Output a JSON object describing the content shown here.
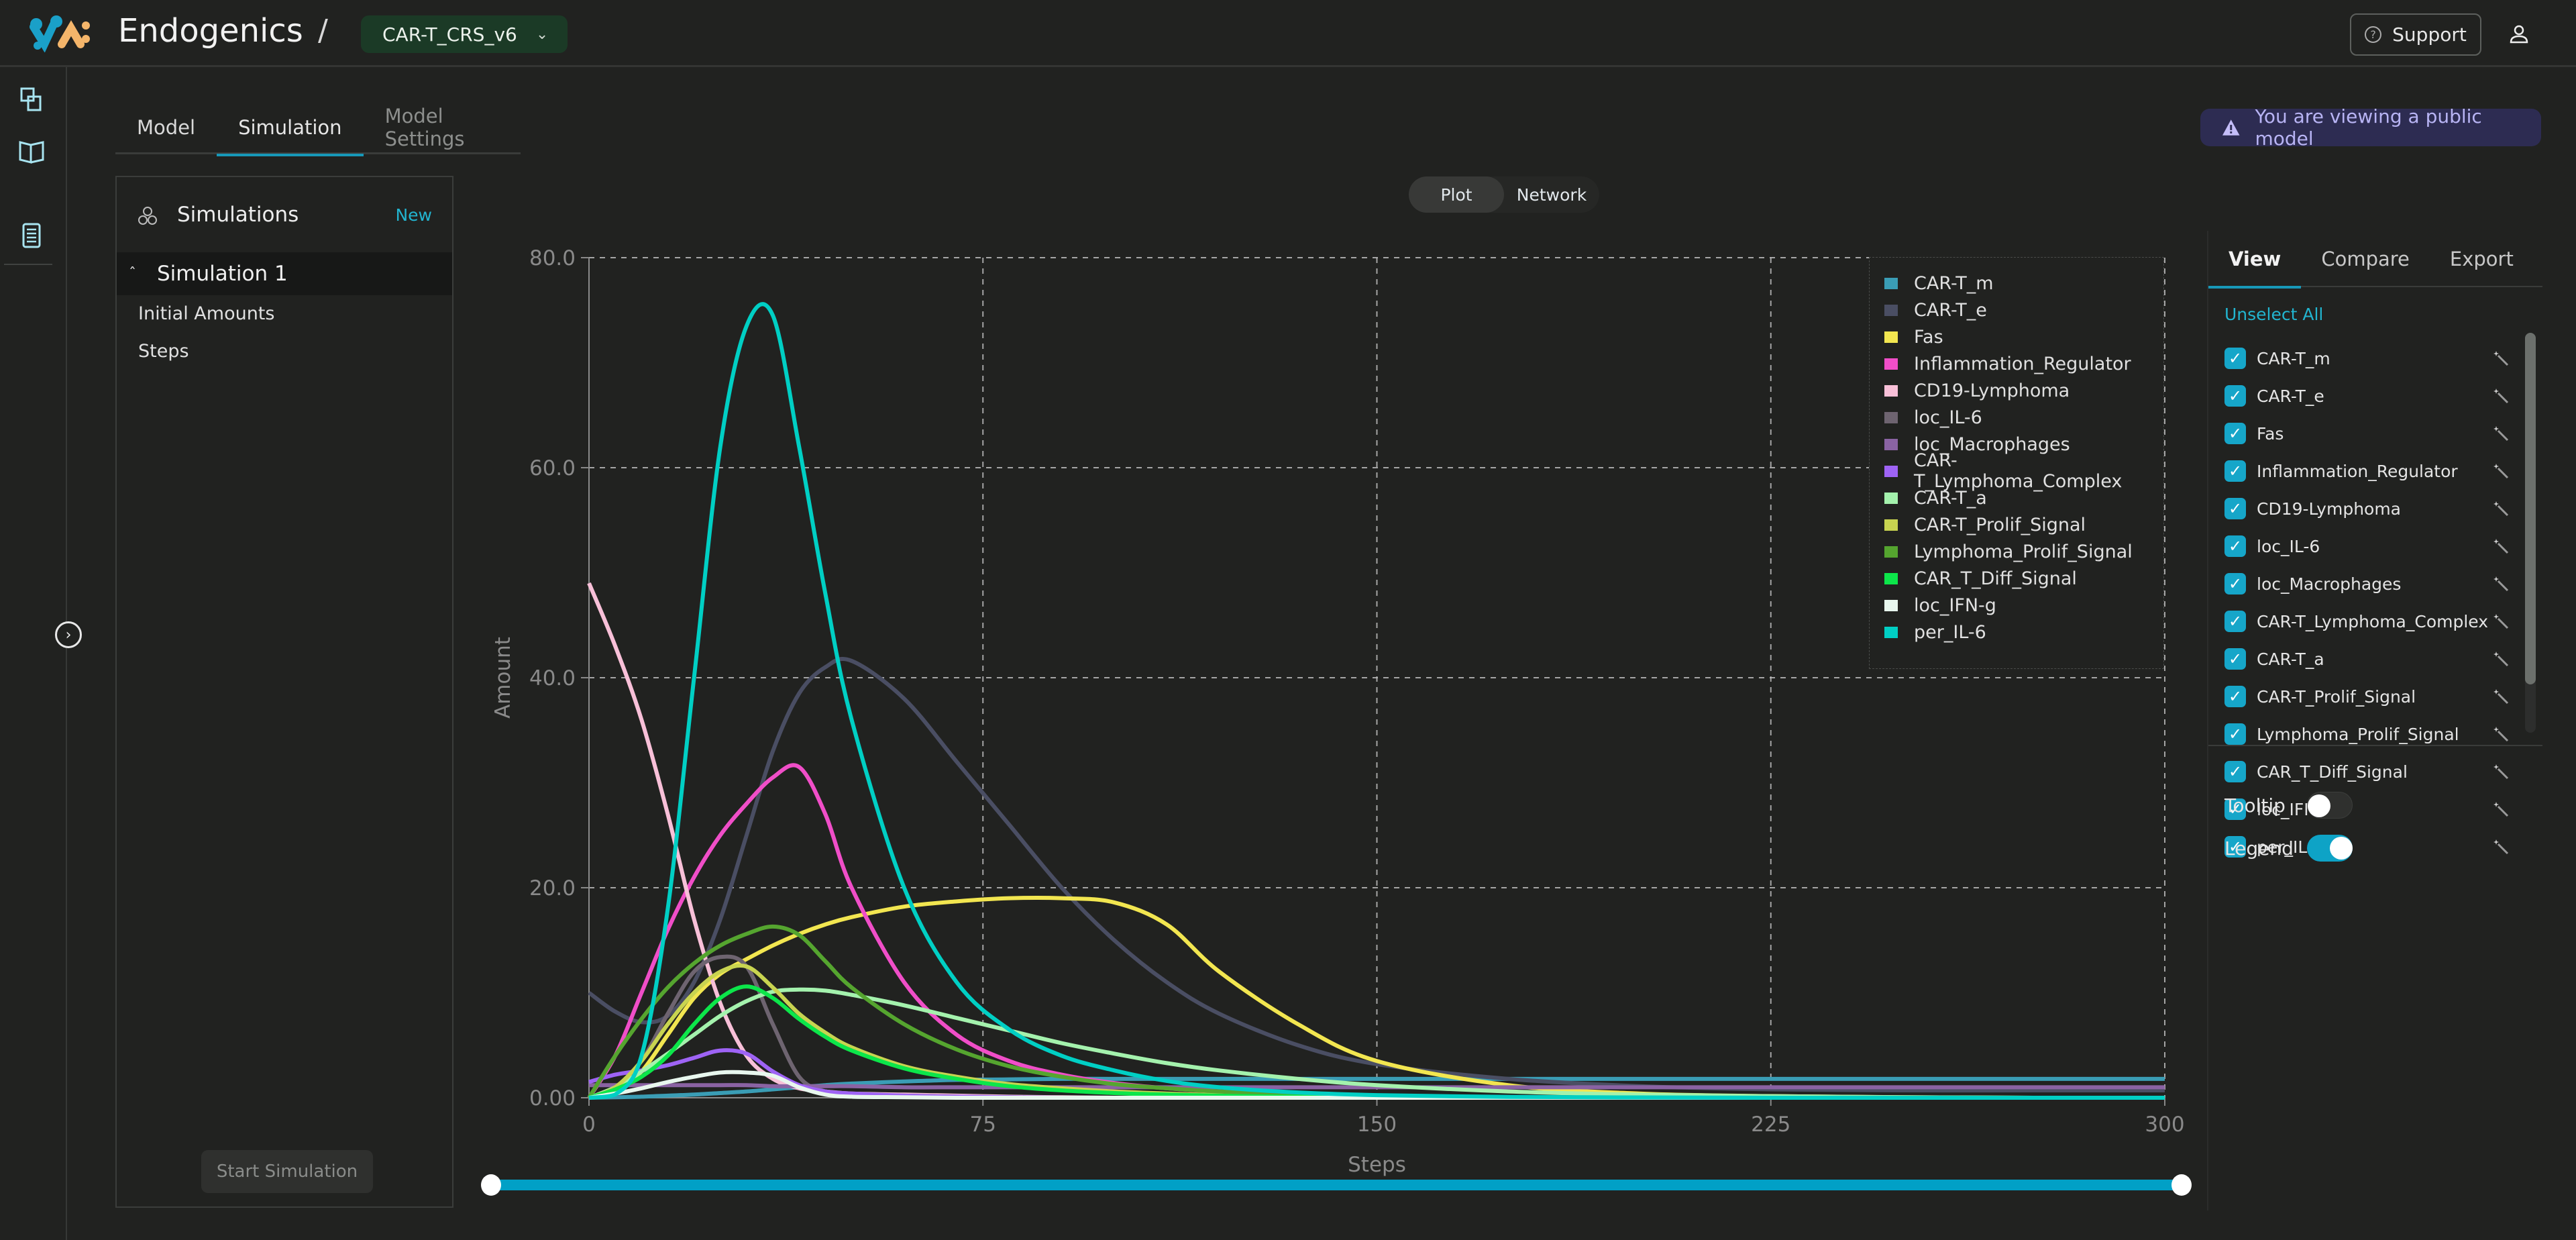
{
  "header": {
    "brand": "Endogenics",
    "separator": "/",
    "model_name": "CAR-T_CRS_v6",
    "support_label": "Support"
  },
  "tabs": [
    {
      "label": "Model",
      "active": false
    },
    {
      "label": "Simulation",
      "active": true
    },
    {
      "label": "Model Settings",
      "active": false
    }
  ],
  "notice": "You are viewing a public model",
  "simulations": {
    "title": "Simulations",
    "new_label": "New",
    "items": [
      {
        "label": "Simulation 1",
        "expanded": true,
        "children": [
          "Initial Amounts",
          "Steps"
        ]
      }
    ],
    "start_label": "Start Simulation"
  },
  "view_switch": {
    "options": [
      "Plot",
      "Network"
    ],
    "selected": "Plot"
  },
  "right_panel": {
    "tabs": [
      "View",
      "Compare",
      "Export"
    ],
    "active_tab": "View",
    "unselect_all": "Unselect All",
    "tooltip_label": "Tooltip",
    "tooltip_on": false,
    "legend_label": "Legend",
    "legend_on": true
  },
  "range_slider": {
    "min": 0,
    "max": 300,
    "start": 0,
    "end": 300
  },
  "chart_data": {
    "type": "line",
    "title": "",
    "xlabel": "Steps",
    "ylabel": "Amount",
    "xlim": [
      0,
      300
    ],
    "ylim": [
      0,
      80
    ],
    "xticks": [
      "0",
      "75",
      "150",
      "225",
      "300"
    ],
    "yticks": [
      "0.00",
      "20.0",
      "40.0",
      "60.0",
      "80.0"
    ],
    "grid": true,
    "legend_position": "top-right",
    "x": [
      0,
      5,
      10,
      15,
      20,
      25,
      30,
      35,
      40,
      45,
      50,
      60,
      70,
      80,
      90,
      100,
      110,
      120,
      135,
      150,
      175,
      200,
      225,
      250,
      275,
      300
    ],
    "series": [
      {
        "name": "CAR-T_m",
        "color": "#3a9db5",
        "values": [
          0,
          0.05,
          0.1,
          0.2,
          0.3,
          0.45,
          0.6,
          0.8,
          1.0,
          1.2,
          1.35,
          1.55,
          1.7,
          1.75,
          1.8,
          1.8,
          1.8,
          1.8,
          1.8,
          1.8,
          1.8,
          1.8,
          1.8,
          1.8,
          1.8,
          1.8
        ]
      },
      {
        "name": "CAR-T_e",
        "color": "#4a4e63",
        "values": [
          10,
          8.2,
          7.2,
          7.8,
          11,
          17,
          25,
          33,
          38.5,
          41,
          41.6,
          38,
          32,
          26,
          20,
          15,
          11,
          8,
          5,
          3.2,
          1.8,
          1.1,
          0.8,
          0.7,
          0.7,
          0.7
        ]
      },
      {
        "name": "Fas",
        "color": "#f2e650",
        "values": [
          0,
          0.5,
          2.5,
          6,
          9.5,
          11.8,
          13.2,
          14.5,
          15.6,
          16.5,
          17.2,
          18.2,
          18.7,
          19,
          19,
          18.6,
          16.5,
          12,
          7,
          3.5,
          1.2,
          0.4,
          0.15,
          0.05,
          0,
          0
        ]
      },
      {
        "name": "Inflammation_Regulator",
        "color": "#f04ec8",
        "values": [
          0,
          4,
          10,
          16,
          21,
          25,
          28,
          30.5,
          31.5,
          27,
          20,
          11,
          6,
          3.5,
          2.2,
          1.4,
          0.9,
          0.6,
          0.3,
          0.15,
          0.05,
          0,
          0,
          0,
          0,
          0
        ]
      },
      {
        "name": "CD19-Lymphoma",
        "color": "#f8c0d8",
        "values": [
          49,
          43,
          36,
          27,
          17,
          9,
          4,
          1.8,
          0.9,
          0.6,
          0.4,
          0.3,
          0.2,
          0.1,
          0.05,
          0,
          0,
          0,
          0,
          0,
          0,
          0,
          0,
          0,
          0,
          0
        ]
      },
      {
        "name": "loc_IL-6",
        "color": "#6e6470",
        "values": [
          0,
          1,
          3.5,
          8,
          12,
          13.4,
          12.5,
          7,
          2,
          0.6,
          0.3,
          0.2,
          0.1,
          0.05,
          0,
          0,
          0,
          0,
          0,
          0,
          0,
          0,
          0,
          0,
          0,
          0
        ]
      },
      {
        "name": "loc_Macrophages",
        "color": "#8a63a3",
        "values": [
          1.2,
          1.2,
          1.2,
          1.2,
          1.2,
          1.2,
          1.2,
          1.1,
          1.1,
          1.1,
          1.1,
          1.0,
          1.0,
          1.0,
          1.0,
          1.0,
          1.0,
          1.0,
          1.0,
          1.0,
          1.0,
          1.0,
          1.0,
          1.0,
          1.0,
          1.0
        ]
      },
      {
        "name": "CAR-T_Lymphoma_Complex",
        "color": "#9e63f5",
        "values": [
          1.5,
          2.2,
          2.6,
          3.1,
          3.8,
          4.5,
          4.2,
          2.5,
          1.2,
          0.6,
          0.4,
          0.2,
          0.1,
          0.05,
          0,
          0,
          0,
          0,
          0,
          0,
          0,
          0,
          0,
          0,
          0,
          0
        ]
      },
      {
        "name": "CAR-T_a",
        "color": "#a4f2ad",
        "values": [
          0,
          1,
          2.5,
          4.2,
          6,
          7.8,
          9.2,
          10.1,
          10.3,
          10.2,
          9.8,
          8.8,
          7.6,
          6.4,
          5.2,
          4.2,
          3.3,
          2.6,
          1.8,
          1.2,
          0.6,
          0.3,
          0.15,
          0.05,
          0,
          0
        ]
      },
      {
        "name": "CAR-T_Prolif_Signal",
        "color": "#c8d450",
        "values": [
          0,
          1,
          3.5,
          7,
          10,
          12,
          12.5,
          10.5,
          8,
          6.2,
          4.8,
          3,
          2,
          1.3,
          0.9,
          0.6,
          0.4,
          0.25,
          0.1,
          0.05,
          0,
          0,
          0,
          0,
          0,
          0
        ]
      },
      {
        "name": "Lymphoma_Prolif_Signal",
        "color": "#55a52f",
        "values": [
          0,
          4,
          7.5,
          10.5,
          12.8,
          14.5,
          15.6,
          16.3,
          15.5,
          13,
          10.5,
          7,
          4.6,
          3,
          2,
          1.3,
          0.9,
          0.6,
          0.3,
          0.15,
          0.05,
          0,
          0,
          0,
          0,
          0
        ]
      },
      {
        "name": "CAR_T_Diff_Signal",
        "color": "#0ce64a",
        "values": [
          0,
          0.8,
          2,
          4,
          7,
          9.5,
          10.6,
          9.5,
          7.5,
          5.8,
          4.5,
          2.8,
          1.8,
          1.1,
          0.7,
          0.45,
          0.3,
          0.2,
          0.1,
          0.05,
          0,
          0,
          0,
          0,
          0,
          0
        ]
      },
      {
        "name": "loc_IFN-g",
        "color": "#e8f7ee",
        "values": [
          0,
          0.4,
          0.9,
          1.5,
          2.0,
          2.4,
          2.4,
          2.1,
          1.0,
          0.3,
          0.1,
          0.05,
          0,
          0,
          0,
          0,
          0,
          0,
          0,
          0,
          0,
          0,
          0,
          0,
          0,
          0
        ]
      },
      {
        "name": "per_IL-6",
        "color": "#00cfc4",
        "values": [
          0,
          0.3,
          4,
          18,
          40,
          62,
          73.5,
          74.5,
          62,
          48,
          36,
          20,
          11,
          6.5,
          4,
          2.6,
          1.6,
          1.0,
          0.5,
          0.25,
          0.08,
          0.03,
          0,
          0,
          0,
          0
        ]
      }
    ]
  }
}
